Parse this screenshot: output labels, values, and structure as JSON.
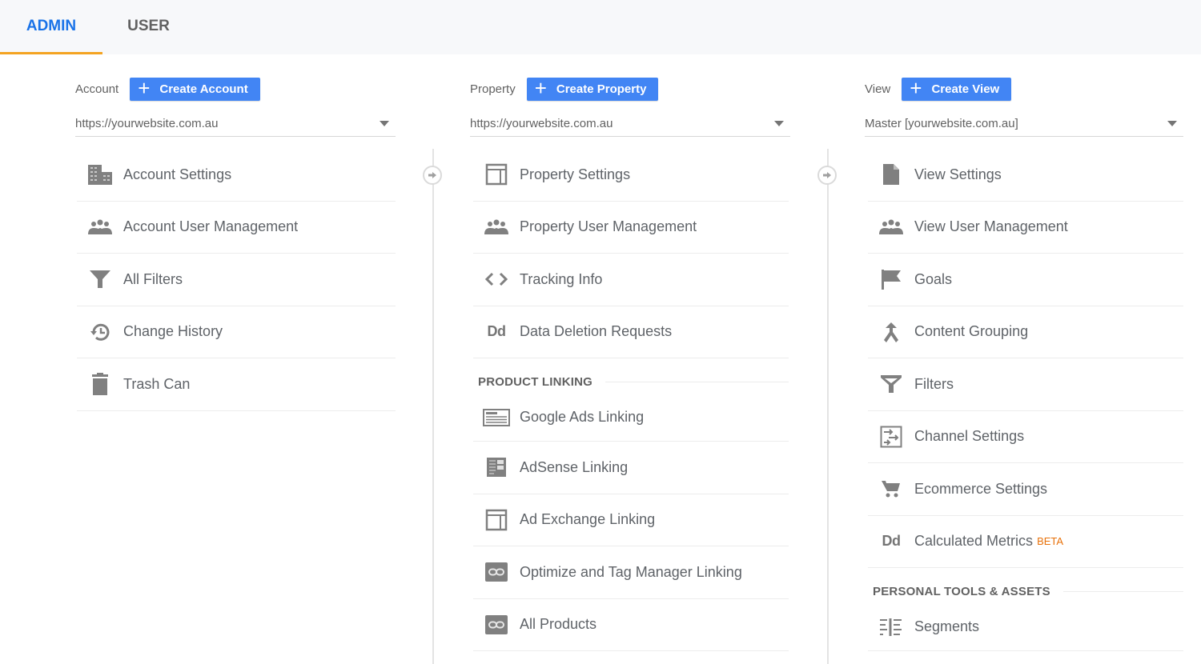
{
  "tabs": [
    {
      "label": "ADMIN",
      "active": true
    },
    {
      "label": "USER",
      "active": false
    }
  ],
  "colors": {
    "accent_blue": "#4285f4",
    "tab_active": "#1a73e8",
    "tab_underline": "#f4a321",
    "beta_orange": "#e8710a"
  },
  "account": {
    "label": "Account",
    "create_button": "Create Account",
    "selector_value": "https://yourwebsite.com.au",
    "items": [
      {
        "label": "Account Settings",
        "icon": "building-icon"
      },
      {
        "label": "Account User Management",
        "icon": "people-icon"
      },
      {
        "label": "All Filters",
        "icon": "filter-icon"
      },
      {
        "label": "Change History",
        "icon": "history-icon"
      },
      {
        "label": "Trash Can",
        "icon": "trash-icon"
      }
    ]
  },
  "property": {
    "label": "Property",
    "create_button": "Create Property",
    "selector_value": "https://yourwebsite.com.au",
    "items": [
      {
        "label": "Property Settings",
        "icon": "layout-icon"
      },
      {
        "label": "Property User Management",
        "icon": "people-icon"
      },
      {
        "label": "Tracking Info",
        "icon": "code-icon"
      },
      {
        "label": "Data Deletion Requests",
        "icon": "dd-icon"
      }
    ],
    "section_title": "PRODUCT LINKING",
    "linking_items": [
      {
        "label": "Google Ads Linking",
        "icon": "ad-window-icon"
      },
      {
        "label": "AdSense Linking",
        "icon": "adsense-icon"
      },
      {
        "label": "Ad Exchange Linking",
        "icon": "layout-icon"
      },
      {
        "label": "Optimize and Tag Manager Linking",
        "icon": "link-icon"
      },
      {
        "label": "All Products",
        "icon": "link-icon"
      }
    ]
  },
  "view": {
    "label": "View",
    "create_button": "Create View",
    "selector_value": "Master [yourwebsite.com.au]",
    "items": [
      {
        "label": "View Settings",
        "icon": "document-icon"
      },
      {
        "label": "View User Management",
        "icon": "people-icon"
      },
      {
        "label": "Goals",
        "icon": "flag-icon"
      },
      {
        "label": "Content Grouping",
        "icon": "merge-icon"
      },
      {
        "label": "Filters",
        "icon": "filter-icon"
      },
      {
        "label": "Channel Settings",
        "icon": "channel-icon"
      },
      {
        "label": "Ecommerce Settings",
        "icon": "cart-icon"
      },
      {
        "label": "Calculated Metrics",
        "icon": "dd-icon",
        "badge": "BETA"
      }
    ],
    "section_title": "PERSONAL TOOLS & ASSETS",
    "personal_items": [
      {
        "label": "Segments",
        "icon": "segments-icon"
      }
    ],
    "dd_glyph": "Dd"
  },
  "property_dd_glyph": "Dd"
}
